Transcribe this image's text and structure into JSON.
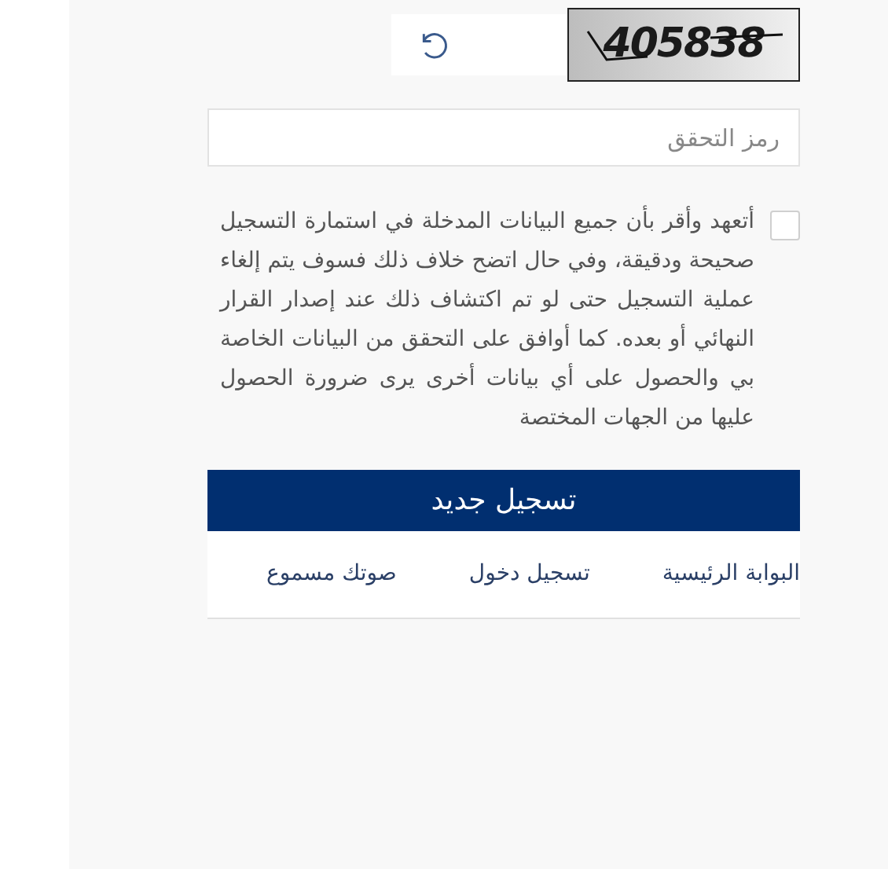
{
  "captcha": {
    "code": "405838"
  },
  "verification_field": {
    "placeholder": "رمز التحقق"
  },
  "agreement": {
    "checked": false,
    "text": "أتعهد وأقر بأن جميع البيانات المدخلة في استمارة التسجيل صحيحة ودقيقة، وفي حال اتضح خلاف ذلك فسوف يتم إلغاء عملية التسجيل حتى لو تم اكتشاف ذلك عند إصدار القرار النهائي أو بعده. كما أوافق على التحقق من البيانات الخاصة بي والحصول على أي بيانات أخرى يرى ضرورة الحصول عليها من الجهات المختصة"
  },
  "register_button": "تسجيل جديد",
  "links": [
    "البوابة الرئيسية",
    "تسجيل دخول",
    "صوتك مسموع"
  ]
}
